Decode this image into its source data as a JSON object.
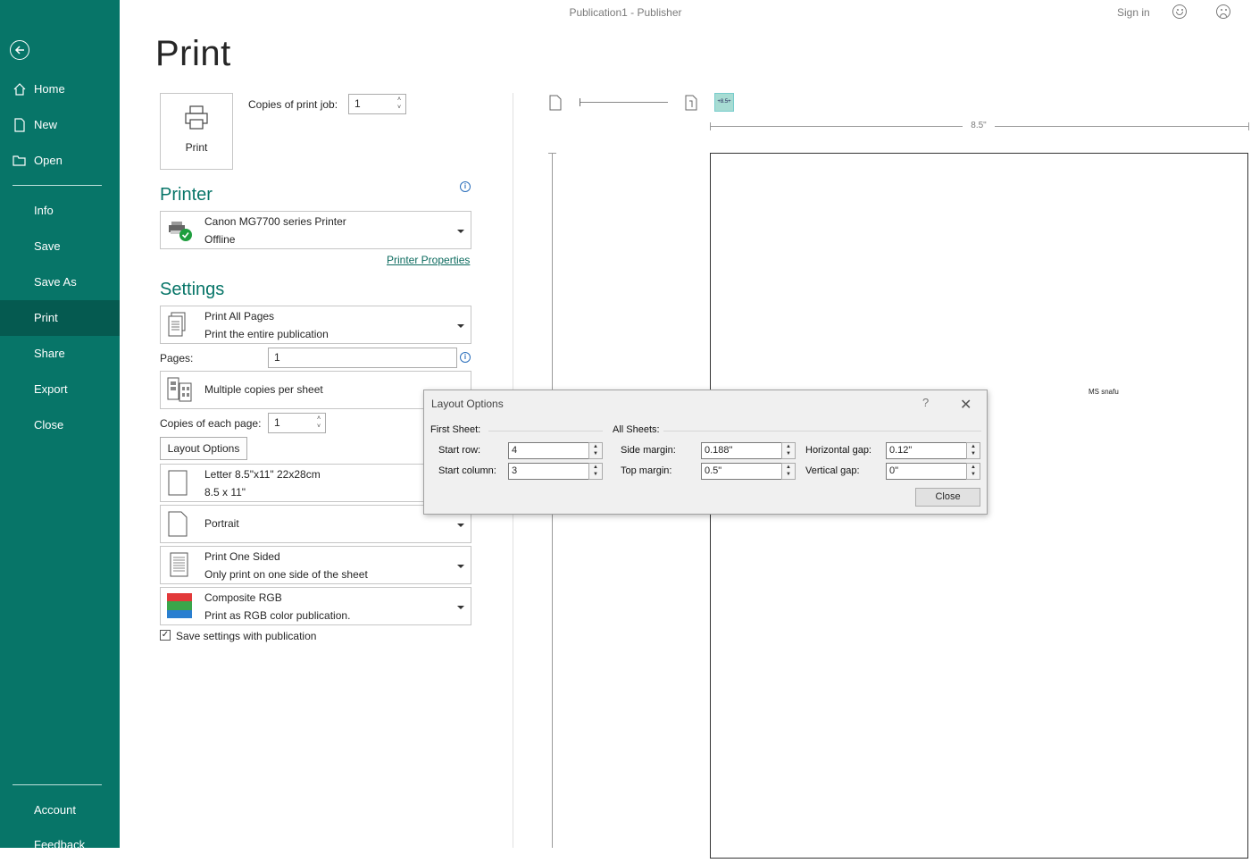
{
  "window": {
    "title": "Publication1  -  Publisher",
    "sign_in": "Sign in",
    "icons": [
      "smile-icon",
      "frown-icon"
    ]
  },
  "sidebar": {
    "items": [
      {
        "label": "Home",
        "icon": "home-icon"
      },
      {
        "label": "New",
        "icon": "new-document-icon"
      },
      {
        "label": "Open",
        "icon": "open-folder-icon"
      },
      {
        "label": "Info"
      },
      {
        "label": "Save"
      },
      {
        "label": "Save As"
      },
      {
        "label": "Print",
        "selected": true
      },
      {
        "label": "Share"
      },
      {
        "label": "Export"
      },
      {
        "label": "Close"
      },
      {
        "label": "Account"
      },
      {
        "label": "Feedback"
      }
    ],
    "accent_color": "#077568"
  },
  "print": {
    "page_title": "Print",
    "print_button": "Print",
    "copies_label": "Copies of print job:",
    "copies_value": "1"
  },
  "printer": {
    "heading": "Printer",
    "name": "Canon MG7700 series Printer",
    "status": "Offline",
    "properties_link": "Printer Properties"
  },
  "settings": {
    "heading": "Settings",
    "pages_scope": {
      "line1": "Print All Pages",
      "line2": "Print the entire publication"
    },
    "pages_label": "Pages:",
    "pages_value": "1",
    "copies_per_sheet": "Multiple copies per sheet",
    "copies_each_label": "Copies of each page:",
    "copies_each_value": "1",
    "layout_options_button": "Layout Options",
    "paper": {
      "line1": "Letter 8.5\"x11\" 22x28cm",
      "line2": "8.5 x 11\""
    },
    "orientation": "Portrait",
    "sides": {
      "line1": "Print One Sided",
      "line2": "Only print on one side of the sheet"
    },
    "color": {
      "line1": "Composite RGB",
      "line2": "Print as RGB color publication."
    },
    "save_settings_label": "Save settings with publication",
    "save_settings_checked": true
  },
  "preview": {
    "ruler_width_label": "8.5\"",
    "zoom_badge": "+8.5+",
    "page_text": "MS snafu"
  },
  "dialog": {
    "title": "Layout Options",
    "help": "?",
    "first_sheet_label": "First Sheet:",
    "all_sheets_label": "All Sheets:",
    "start_row_label": "Start row:",
    "start_row_value": "4",
    "start_column_label": "Start column:",
    "start_column_value": "3",
    "side_margin_label": "Side margin:",
    "side_margin_value": "0.188\"",
    "top_margin_label": "Top margin:",
    "top_margin_value": "0.5\"",
    "horizontal_gap_label": "Horizontal gap:",
    "horizontal_gap_value": "0.12\"",
    "vertical_gap_label": "Vertical gap:",
    "vertical_gap_value": "0\"",
    "close_button": "Close"
  }
}
